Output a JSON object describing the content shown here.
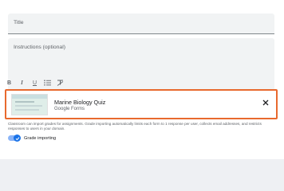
{
  "form": {
    "title_placeholder": "Title",
    "instructions_placeholder": "Instructions (optional)"
  },
  "toolbar": {
    "bold": "B",
    "italic": "I",
    "underline": "U",
    "list_icon": "bulleted-list-icon",
    "clear_icon": "clear-formatting-icon"
  },
  "attachment": {
    "title": "Marine Biology Quiz",
    "subtitle": "Google Forms",
    "close_icon": "close-icon",
    "highlight_color": "#e8692e"
  },
  "note": "Classroom can import grades for assignments. Grade importing automatically limits each form to 1 response per user, collects email addresses, and restricts responses to users in your domain.",
  "grade_toggle": {
    "label": "Grade importing",
    "state": true,
    "color": "#1a73e8"
  }
}
